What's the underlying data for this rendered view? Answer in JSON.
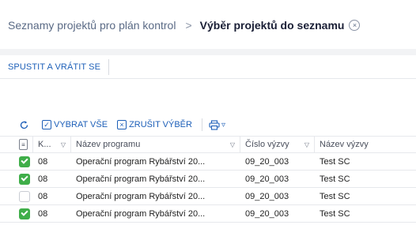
{
  "breadcrumb": {
    "previous": "Seznamy projektů pro plán kontrol",
    "separator": ">",
    "current": "Výběr projektů do seznamu",
    "close_glyph": "×"
  },
  "actionbar": {
    "run_and_return_label": "SPUSTIT A VRÁTIT SE"
  },
  "toolbar": {
    "refresh_icon": "refresh-icon",
    "select_all_label": "VYBRAT VŠE",
    "select_all_glyph": "✓",
    "clear_selection_label": "ZRUŠIT VÝBĚR",
    "clear_selection_glyph": "×",
    "print_icon": "print-icon",
    "print_dropdown_glyph": "▿"
  },
  "table": {
    "filter_glyph": "≡",
    "sort_glyph": "▽",
    "columns": [
      "K...",
      "Název programu",
      "Číslo výzvy",
      "Název výzvy"
    ],
    "rows": [
      {
        "selected": true,
        "code": "08",
        "program": "Operační program Rybářství 20...",
        "call_number": "09_20_003",
        "call_name": "Test SC"
      },
      {
        "selected": true,
        "code": "08",
        "program": "Operační program Rybářství 20...",
        "call_number": "09_20_003",
        "call_name": "Test SC"
      },
      {
        "selected": false,
        "code": "08",
        "program": "Operační program Rybářství 20...",
        "call_number": "09_20_003",
        "call_name": "Test SC"
      },
      {
        "selected": true,
        "code": "08",
        "program": "Operační program Rybářství 20...",
        "call_number": "09_20_003",
        "call_name": "Test SC"
      }
    ]
  },
  "colors": {
    "accent": "#1d5fb8",
    "checked": "#3fae49"
  }
}
